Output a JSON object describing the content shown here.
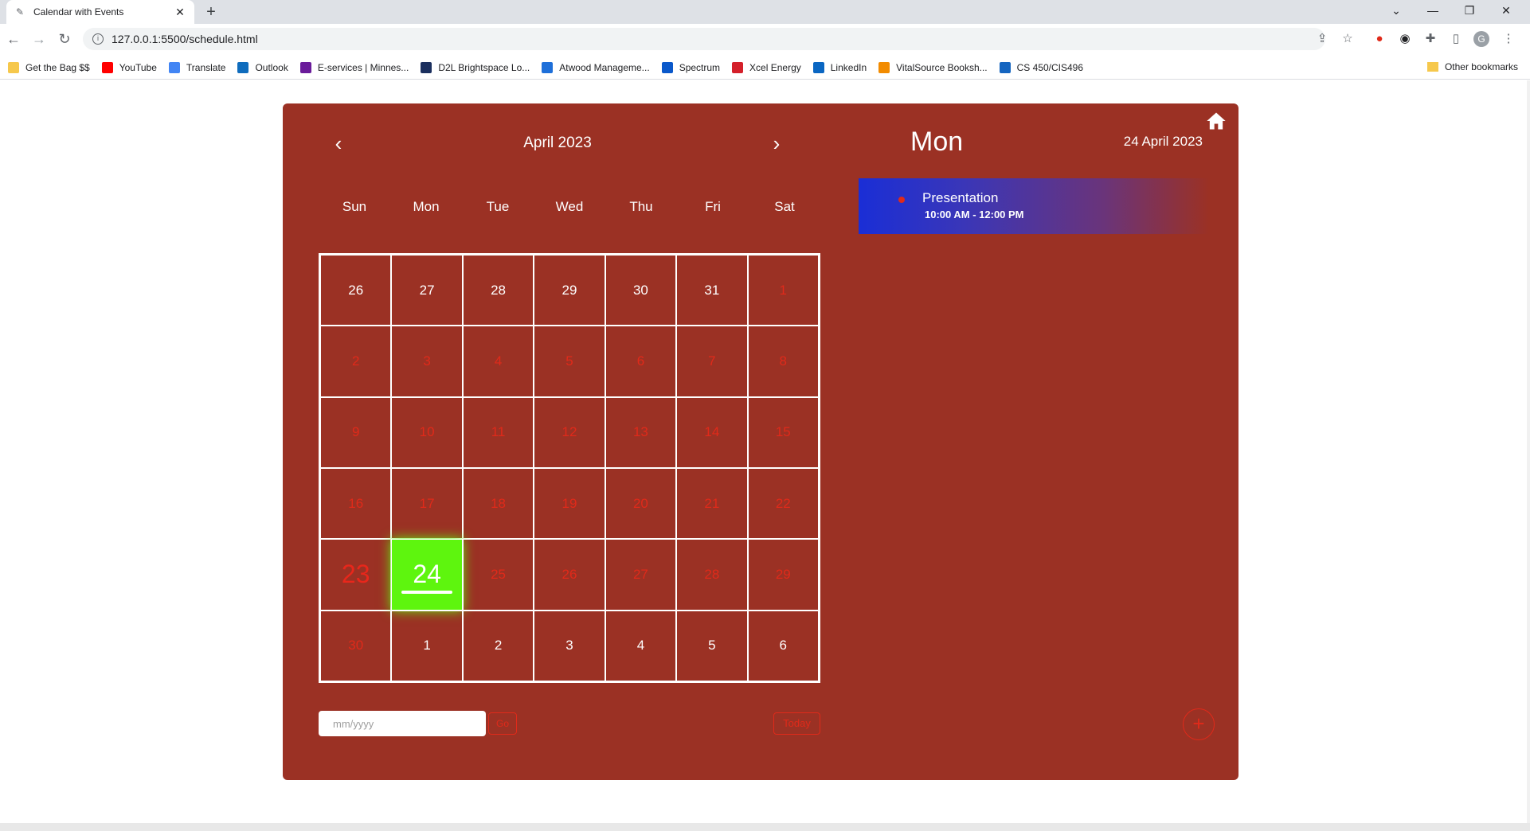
{
  "browser": {
    "tab_title": "Calendar with Events",
    "tab_close": "✕",
    "new_tab": "+",
    "url": "127.0.0.1:5500/schedule.html",
    "window_controls": [
      "⌄",
      "—",
      "❐",
      "✕"
    ]
  },
  "bookmarks": [
    {
      "label": "Get the Bag $$",
      "icon": "folder-icon",
      "color": "#f6c84c"
    },
    {
      "label": "YouTube",
      "icon": "youtube-icon",
      "color": "#ff0000"
    },
    {
      "label": "Translate",
      "icon": "translate-icon",
      "color": "#4285f4"
    },
    {
      "label": "Outlook",
      "icon": "outlook-icon",
      "color": "#0f6cbd"
    },
    {
      "label": "E-services | Minnes...",
      "icon": "eservices-icon",
      "color": "#6a1b9a"
    },
    {
      "label": "D2L Brightspace Lo...",
      "icon": "d2l-icon",
      "color": "#1b2f5e"
    },
    {
      "label": "Atwood Manageme...",
      "icon": "atwood-icon",
      "color": "#1e6fd9"
    },
    {
      "label": "Spectrum",
      "icon": "spectrum-icon",
      "color": "#0a58ca"
    },
    {
      "label": "Xcel Energy",
      "icon": "xcel-icon",
      "color": "#d4202a"
    },
    {
      "label": "LinkedIn",
      "icon": "linkedin-icon",
      "color": "#0a66c2"
    },
    {
      "label": "VitalSource Booksh...",
      "icon": "vitalsource-icon",
      "color": "#f28b00"
    },
    {
      "label": "CS 450/CIS496",
      "icon": "cs-icon",
      "color": "#1565c0"
    }
  ],
  "other_bookmarks": "Other bookmarks",
  "calendar": {
    "month_label": "April 2023",
    "prev": "‹",
    "next": "›",
    "weekdays": [
      "Sun",
      "Mon",
      "Tue",
      "Wed",
      "Thu",
      "Fri",
      "Sat"
    ],
    "weeks": [
      [
        "26",
        "27",
        "28",
        "29",
        "30",
        "31",
        "1"
      ],
      [
        "2",
        "3",
        "4",
        "5",
        "6",
        "7",
        "8"
      ],
      [
        "9",
        "10",
        "11",
        "12",
        "13",
        "14",
        "15"
      ],
      [
        "16",
        "17",
        "18",
        "19",
        "20",
        "21",
        "22"
      ],
      [
        "23",
        "24",
        "25",
        "26",
        "27",
        "28",
        "29"
      ],
      [
        "30",
        "1",
        "2",
        "3",
        "4",
        "5",
        "6"
      ]
    ],
    "date_input_placeholder": "mm/yyyy",
    "go_label": "Go",
    "today_label": "Today"
  },
  "day_panel": {
    "day_name": "Mon",
    "full_date": "24 April 2023",
    "event": {
      "title": "Presentation",
      "time": "10:00 AM - 12:00 PM"
    },
    "add_label": "+"
  },
  "colors": {
    "card": "#9b3124",
    "today_cell": "#5ef50e",
    "accent_red": "#e02a1a"
  }
}
